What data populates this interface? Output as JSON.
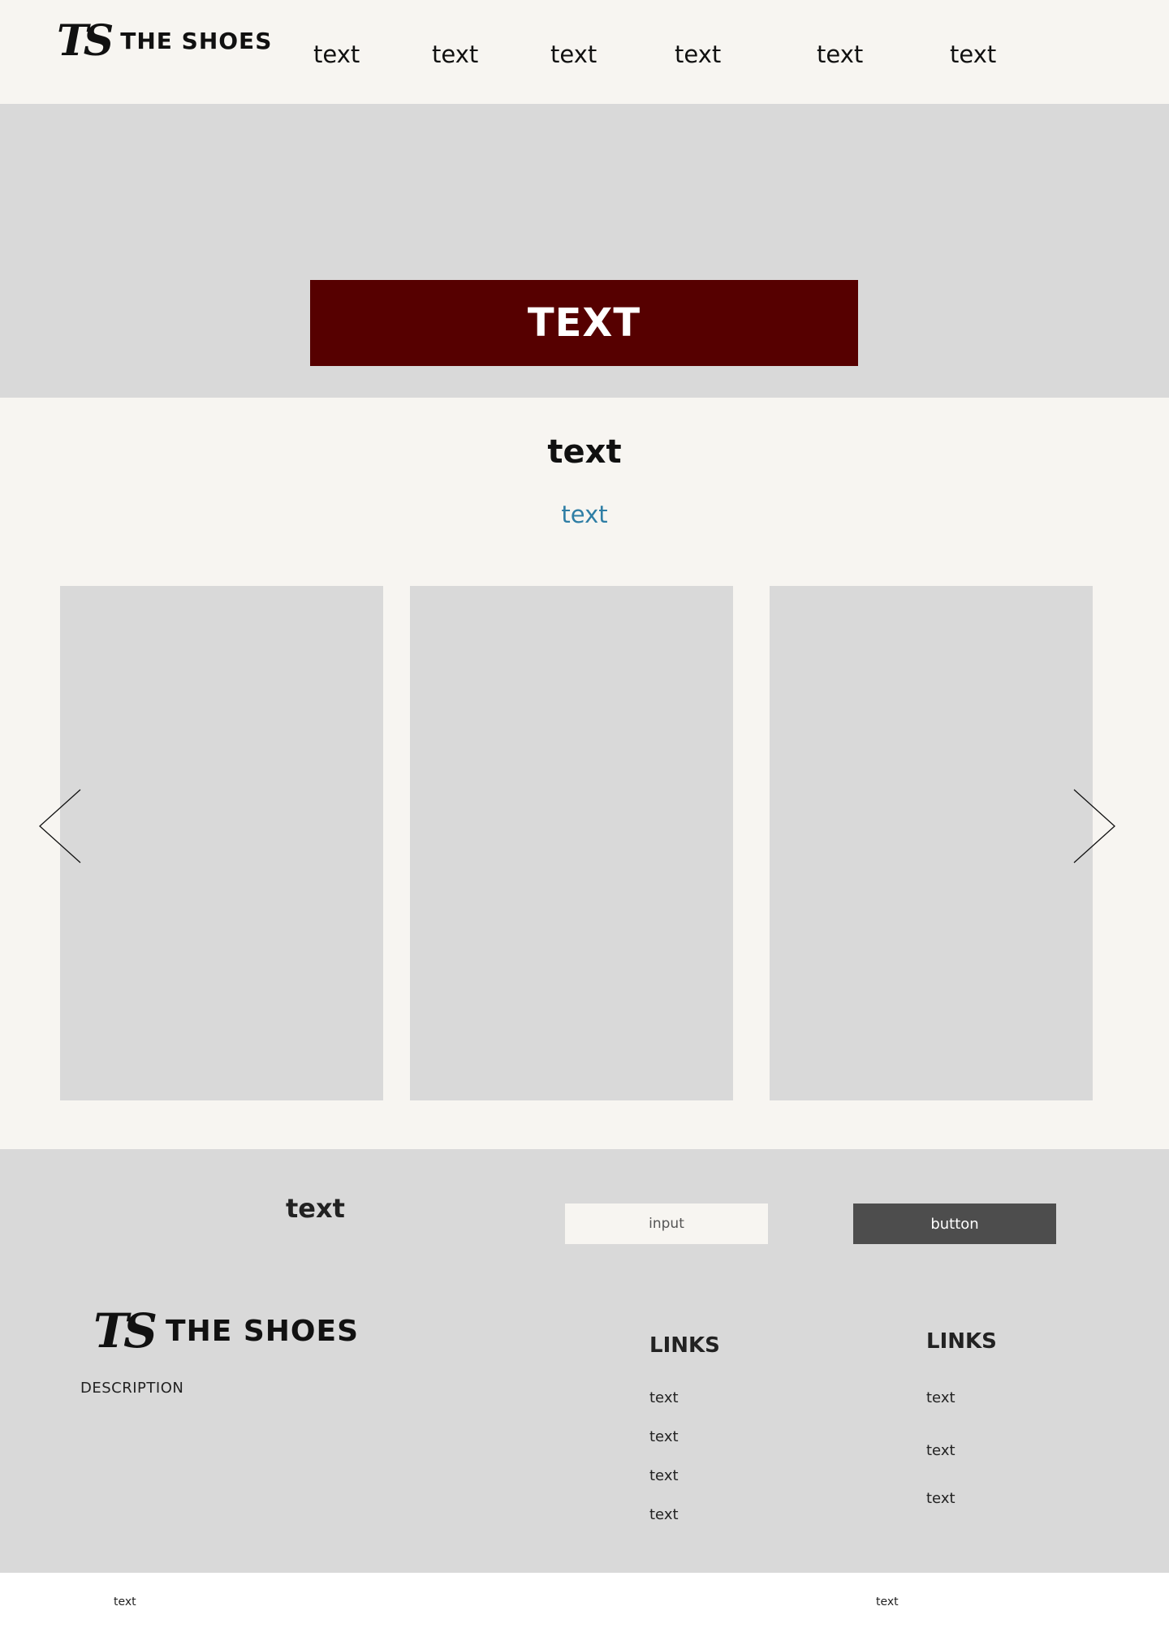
{
  "header": {
    "logo_mark": "TS",
    "brand": "THE SHOES",
    "nav": [
      "text",
      "text",
      "text",
      "text",
      "text",
      "text"
    ]
  },
  "hero": {
    "cta_label": "TEXT",
    "cta_color": "#560000"
  },
  "products": {
    "title": "text",
    "subtitle": "text",
    "subtitle_color": "#2f7ea5",
    "prev_icon": "chevron-left-icon",
    "next_icon": "chevron-right-icon"
  },
  "footer": {
    "newsletter": {
      "title": "text",
      "input_placeholder": "input",
      "button_label": "button"
    },
    "logo_mark": "TS",
    "brand": "THE SHOES",
    "description": "DESCRIPTION",
    "columns": [
      {
        "heading": "LINKS",
        "links": [
          "text",
          "text",
          "text",
          "text"
        ]
      },
      {
        "heading": "LINKS",
        "links": [
          "text",
          "text",
          "text"
        ]
      }
    ]
  },
  "bottom_bar": {
    "left": "text",
    "right": "text"
  }
}
